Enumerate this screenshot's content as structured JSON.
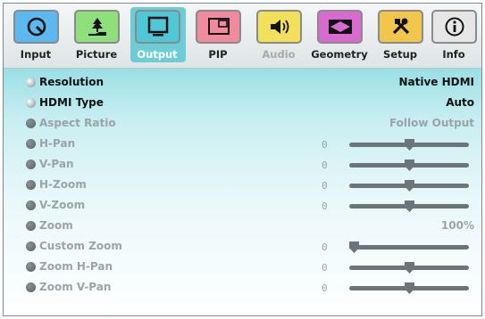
{
  "tabs": [
    {
      "key": "input",
      "label": "Input",
      "icon": "input-icon",
      "color": "#5bb8f0"
    },
    {
      "key": "picture",
      "label": "Picture",
      "icon": "picture-icon",
      "color": "#8ee07a"
    },
    {
      "key": "output",
      "label": "Output",
      "icon": "output-icon",
      "color": "#4fc7d6"
    },
    {
      "key": "pip",
      "label": "PIP",
      "icon": "pip-icon",
      "color": "#f08a9c"
    },
    {
      "key": "audio",
      "label": "Audio",
      "icon": "audio-icon",
      "color": "#f2e05a"
    },
    {
      "key": "geometry",
      "label": "Geometry",
      "icon": "geometry-icon",
      "color": "#d86ad0"
    },
    {
      "key": "setup",
      "label": "Setup",
      "icon": "setup-icon",
      "color": "#f2c64a"
    },
    {
      "key": "info",
      "label": "Info",
      "icon": "info-icon",
      "color": "#e6e6e6"
    }
  ],
  "selected_tab": "Output",
  "menu": {
    "resolution": {
      "label": "Resolution",
      "value": "Native HDMI"
    },
    "hdmi_type": {
      "label": "HDMI Type",
      "value": "Auto"
    },
    "aspect_ratio": {
      "label": "Aspect Ratio",
      "value": "Follow Output"
    },
    "h_pan": {
      "label": "H-Pan",
      "value": "0",
      "level": 0.5
    },
    "v_pan": {
      "label": "V-Pan",
      "value": "0",
      "level": 0.5
    },
    "h_zoom": {
      "label": "H-Zoom",
      "value": "0",
      "level": 0.5
    },
    "v_zoom": {
      "label": "V-Zoom",
      "value": "0",
      "level": 0.5
    },
    "zoom": {
      "label": "Zoom",
      "value": "100%"
    },
    "custom_zoom": {
      "label": "Custom Zoom",
      "value": "0",
      "level": 0.0
    },
    "zoom_h_pan": {
      "label": "Zoom H-Pan",
      "value": "0",
      "level": 0.5
    },
    "zoom_v_pan": {
      "label": "Zoom V-Pan",
      "value": "0",
      "level": 0.5
    }
  }
}
